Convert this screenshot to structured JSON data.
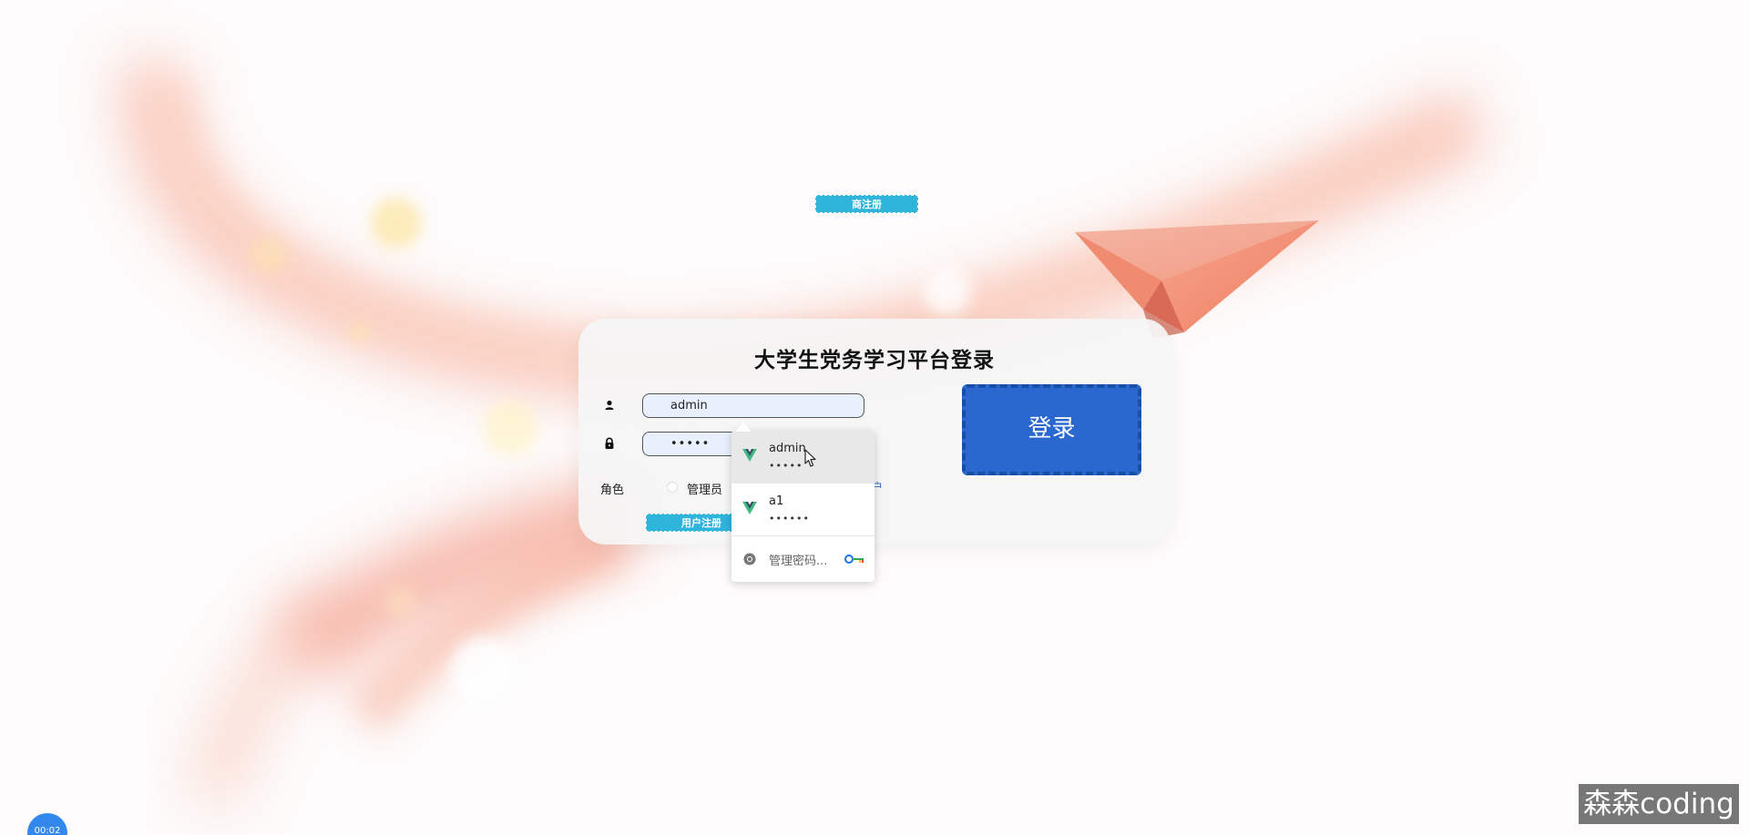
{
  "login_card": {
    "title": "大学生党务学习平台登录",
    "username_value": "admin",
    "password_value": "•••••",
    "role_label": "角色",
    "role_option": "管理员",
    "register_user_button": "用户注册",
    "register_other_button": "商注册",
    "login_button": "登录",
    "partial_link": "户"
  },
  "autofill_dropdown": {
    "items": [
      {
        "username": "admin",
        "password_mask": "•••••"
      },
      {
        "username": "a1",
        "password_mask": "••••••"
      }
    ],
    "manage_label": "管理密码..."
  },
  "recording_timer": "00:02",
  "watermark": "森森coding",
  "colors": {
    "login_button": "#2a68d0",
    "register_button": "#2fb4dc",
    "autofill_field": "#e8f0fe",
    "vue_logo_green": "#41b883",
    "vue_logo_dark": "#35495e"
  },
  "icons": {
    "username": "user-icon",
    "password": "lock-icon",
    "saved_password_logo": "vue-logo-icon",
    "manage": "chrome-icon",
    "key": "key-icon",
    "cursor": "mouse-cursor-icon"
  }
}
